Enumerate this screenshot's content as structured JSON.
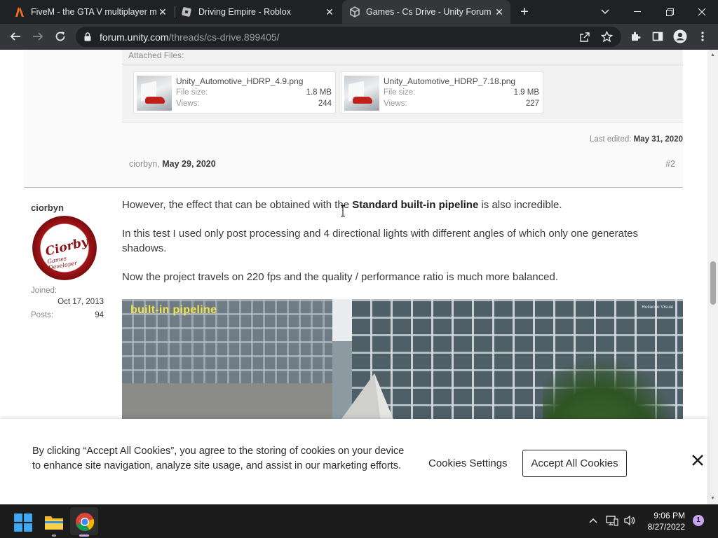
{
  "browser": {
    "tabs": [
      {
        "title": "FiveM - the GTA V multiplayer m",
        "favicon": "fivem-icon",
        "active": false
      },
      {
        "title": "Driving Empire - Roblox",
        "favicon": "roblox-icon",
        "active": false
      },
      {
        "title": "Games - Cs Drive - Unity Forum",
        "favicon": "unity-icon",
        "active": true
      }
    ],
    "new_tab_label": "+",
    "url_domain": "forum.unity.com",
    "url_path": "/threads/cs-drive.899405/"
  },
  "previous_post": {
    "attached_title": "Attached Files:",
    "files": [
      {
        "name": "Unity_Automotive_HDRP_4.9.png",
        "size_label": "File size:",
        "size": "1.8 MB",
        "views_label": "Views:",
        "views": "244"
      },
      {
        "name": "Unity_Automotive_HDRP_7.18.png",
        "size_label": "File size:",
        "size": "1.9 MB",
        "views_label": "Views:",
        "views": "227"
      }
    ],
    "last_edited_label": "Last edited:",
    "last_edited_date": "May 31, 2020",
    "author": "ciorbyn",
    "date": "May 29, 2020",
    "number": "#2"
  },
  "post": {
    "username": "ciorbyn",
    "avatar_text": "Ciorbyn",
    "avatar_sub": "Games Developer",
    "joined_label": "Joined:",
    "joined": "Oct 17, 2013",
    "posts_label": "Posts:",
    "posts": "94",
    "para1_before": "However, the effect that can be obtained with the ",
    "para1_bold": "Standard built-in pipeline",
    "para1_after": " is also incredible.",
    "para2": "In this test I used only post processing and 4 directional lights with different angles of which only one generates shadows.",
    "para3": "Now the project travels on 220 fps and the quality / performance ratio is much more balanced.",
    "image_caption": "built-in pipeline",
    "image_watermark": "Reliance Visual"
  },
  "cookie": {
    "text": "By clicking “Accept All Cookies”, you agree to the storing of cookies on your device to enhance site navigation, analyze site usage, and assist in our marketing efforts.",
    "settings_label": "Cookies Settings",
    "accept_label": "Accept All Cookies"
  },
  "taskbar": {
    "time": "9:06 PM",
    "date": "8/27/2022",
    "notification_count": "1"
  }
}
